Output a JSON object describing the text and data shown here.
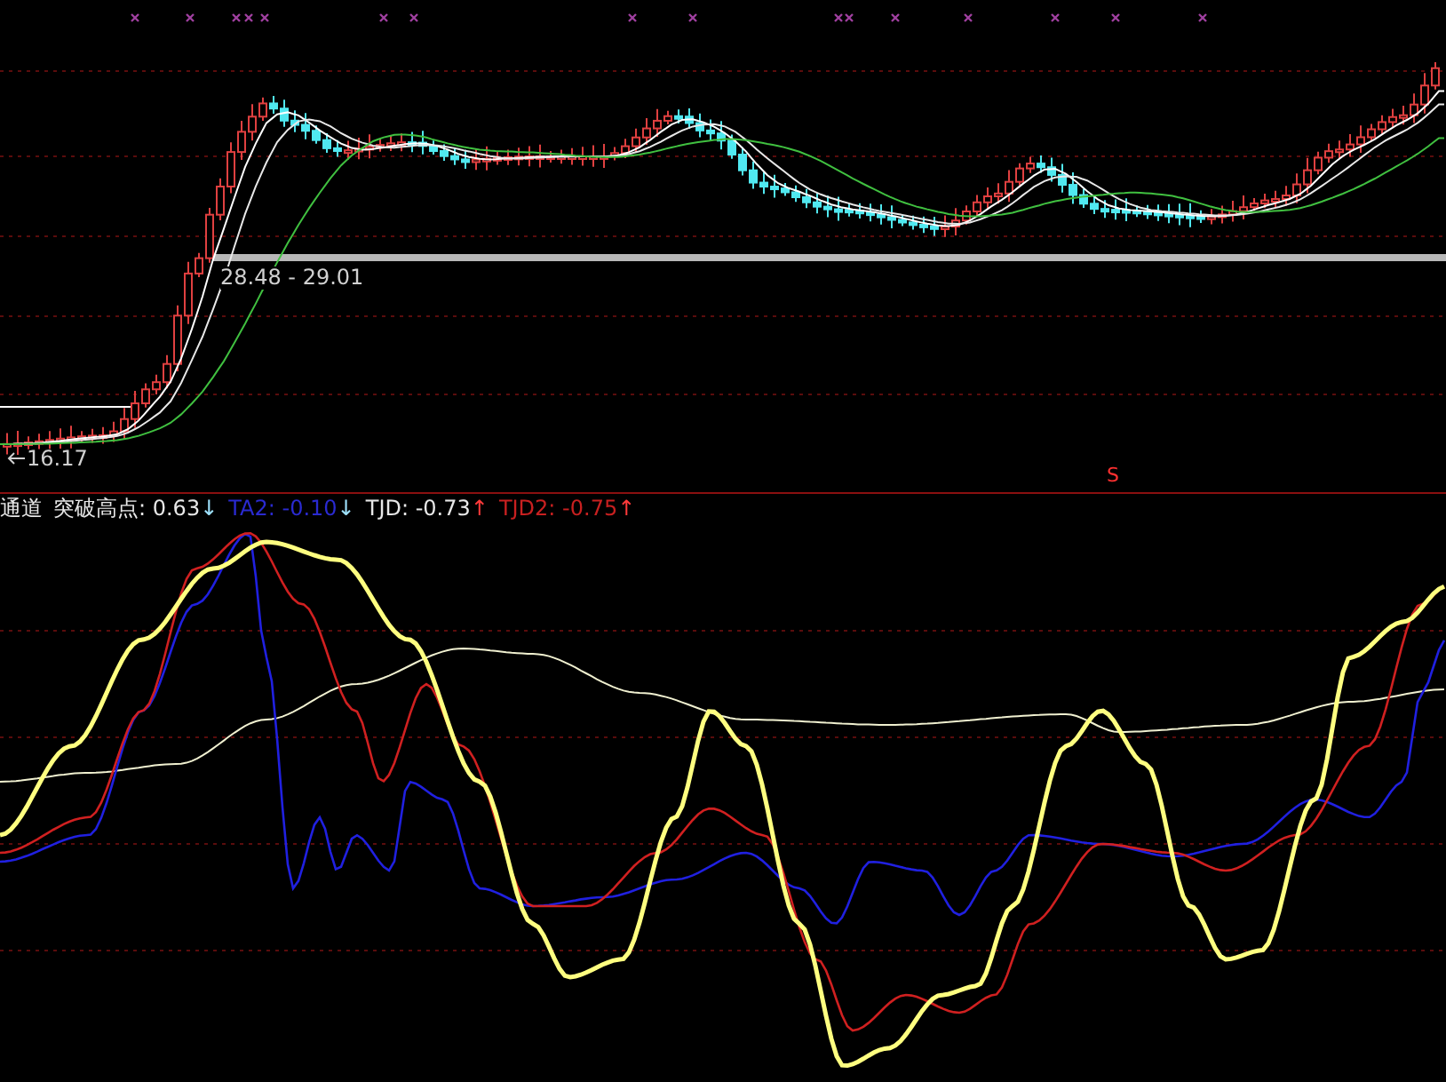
{
  "upper_panel": {
    "range_label": "28.48 - 29.01",
    "low_label": "16.17"
  },
  "lower_panel": {
    "legend": [
      {
        "text": "通道",
        "color": "#e8e8e8"
      },
      {
        "text": "突破高点: 0.63",
        "color": "#e8e8e8",
        "arrow": {
          "text": "↓",
          "color": "#9fe3ff"
        }
      },
      {
        "text": "TA2: -0.10",
        "color": "#2a2ad0",
        "arrow": {
          "text": "↓",
          "color": "#9fe3ff"
        }
      },
      {
        "text": "TJD: -0.73",
        "color": "#e8e8e8",
        "arrow": {
          "text": "↑",
          "color": "#ff3a3a"
        }
      },
      {
        "text": "TJD2: -0.75",
        "color": "#c82020",
        "arrow": {
          "text": "↑",
          "color": "#ff3a3a"
        }
      }
    ],
    "signal": "S"
  }
}
